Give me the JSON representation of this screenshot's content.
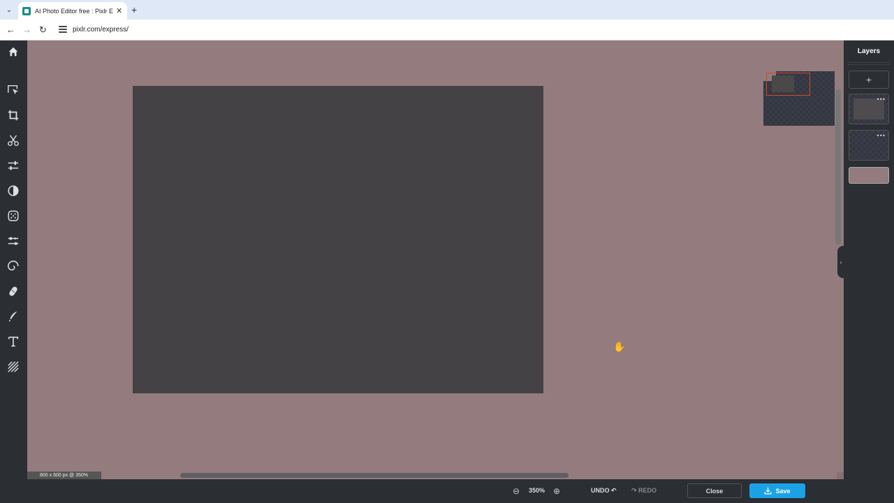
{
  "browser": {
    "tab_title": "AI Photo Editor free : Pixlr Express",
    "tab_close": "✕",
    "new_tab": "+",
    "url": "pixlr.com/express/"
  },
  "toolbar": {
    "home_icon": "home-icon",
    "tools": [
      "arrange-icon",
      "crop-icon",
      "cutout-icon",
      "adjust-icon",
      "filter-icon",
      "effect-icon",
      "liquify-icon",
      "swirl-icon",
      "retouch-icon",
      "draw-icon",
      "text-icon",
      "pattern-icon"
    ]
  },
  "canvas": {
    "size_info": "800 x 600 px @ 350%",
    "background_color": "#937b7e",
    "artboard_color": "#444244"
  },
  "layers": {
    "title": "Layers",
    "add_label": "+",
    "more_label": "•••"
  },
  "bottom": {
    "zoom_level": "350%",
    "undo": "UNDO ↶",
    "redo": "↷ REDO",
    "close": "Close",
    "save": "Save"
  },
  "colors": {
    "accent": "#1ba2e6",
    "panel_bg": "#2b2e33"
  }
}
